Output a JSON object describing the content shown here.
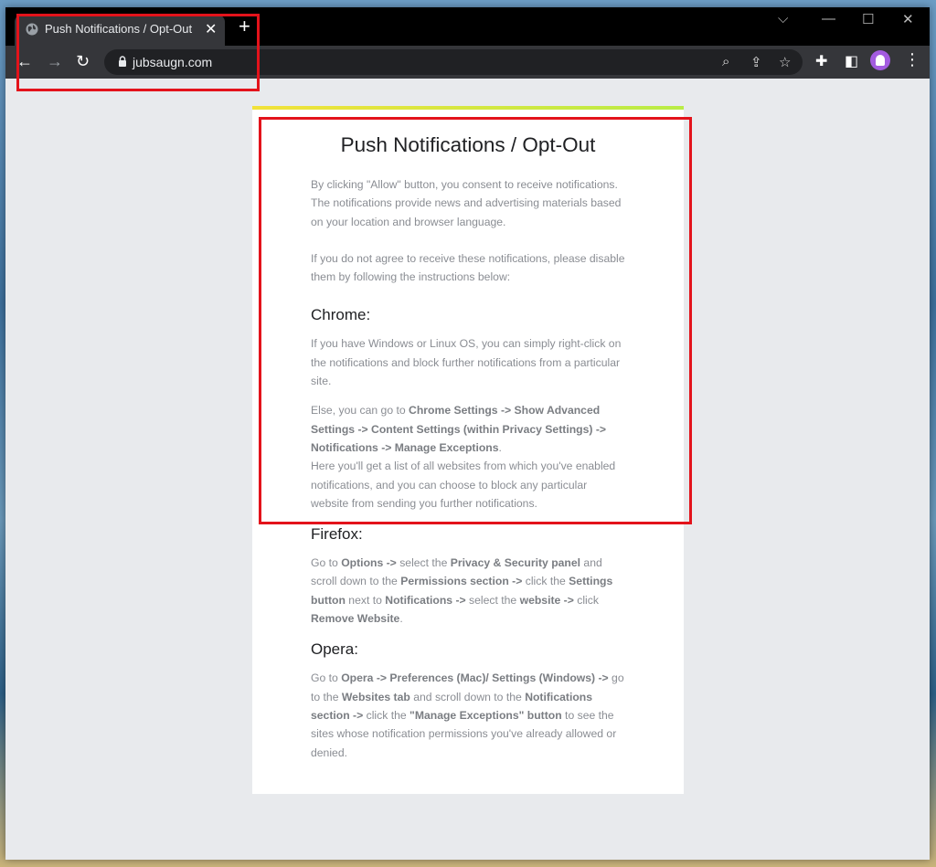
{
  "browser": {
    "tab_title": "Push Notifications / Opt-Out",
    "url": "jubsaugn.com"
  },
  "page": {
    "title": "Push Notifications / Opt-Out",
    "intro_1": "By clicking \"Allow\" button, you consent to receive notifications. The notifications provide news and advertising materials based on your location and browser language.",
    "intro_2": "If you do not agree to receive these notifications, please disable them by following the instructions below:",
    "chrome": {
      "heading": "Chrome:",
      "p1": "If you have Windows or Linux OS, you can simply right-click on the notifications and block further notifications from a particular site.",
      "p2_pre": "Else, you can go to ",
      "p2_bold": "Chrome Settings -> Show Advanced Settings -> Content Settings (within Privacy Settings) -> Notifications -> Manage Exceptions",
      "p2_post": ".",
      "p3": "Here you'll get a list of all websites from which you've enabled notifications, and you can choose to block any particular website from sending you further notifications."
    },
    "firefox": {
      "heading": "Firefox:",
      "t1": "Go to ",
      "b1": "Options ->",
      "t2": " select the ",
      "b2": "Privacy & Security panel",
      "t3": " and scroll down to the ",
      "b3": "Permissions section ->",
      "t4": " click the ",
      "b4": "Settings button",
      "t5": " next to ",
      "b5": "Notifications ->",
      "t6": " select the ",
      "b6": "website ->",
      "t7": " click ",
      "b7": "Remove Website",
      "t8": "."
    },
    "opera": {
      "heading": "Opera:",
      "t1": "Go to ",
      "b1": "Opera -> Preferences (Mac)/ Settings (Windows) ->",
      "t2": " go to the ",
      "b2": "Websites tab",
      "t3": " and scroll down to the ",
      "b3": "Notifications section ->",
      "t4": " click the ",
      "b4": "\"Manage Exceptions\" button",
      "t5": " to see the sites whose notification permissions you've already allowed or denied."
    }
  }
}
